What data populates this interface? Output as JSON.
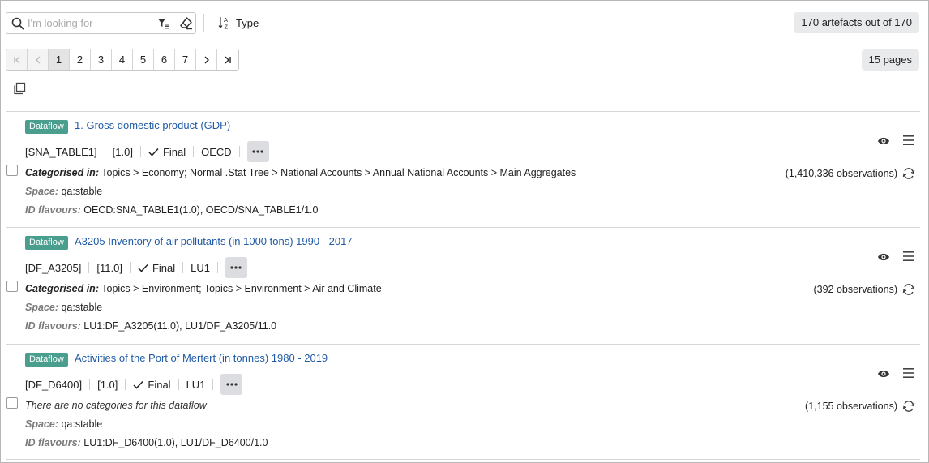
{
  "search": {
    "placeholder": "I'm looking for",
    "value": ""
  },
  "sort": {
    "label": "Type"
  },
  "summary": {
    "count_label": "170 artefacts out of 170",
    "pages_label": "15 pages"
  },
  "pagination": {
    "pages": [
      "1",
      "2",
      "3",
      "4",
      "5",
      "6",
      "7"
    ],
    "current": "1"
  },
  "icons": [
    "search-icon",
    "filter-icon",
    "eraser-icon",
    "sort-icon",
    "copy-icon",
    "first-page-icon",
    "prev-page-icon",
    "next-page-icon",
    "last-page-icon",
    "check-icon",
    "more-icon",
    "eye-icon",
    "menu-icon",
    "refresh-icon"
  ],
  "colors": {
    "badge": "#4a9e8e",
    "link": "#1f5aa6",
    "pill_bg": "#e9eaeb"
  },
  "items": [
    {
      "badge": "Dataflow",
      "title": "1. Gross domestic product (GDP)",
      "id": "[SNA_TABLE1]",
      "version": "[1.0]",
      "status": "Final",
      "agency": "OECD",
      "categorised_label": "Categorised in:",
      "categorised": "Topics > Economy; Normal .Stat Tree > National Accounts > Annual National Accounts > Main Aggregates",
      "space_label": "Space:",
      "space": "qa:stable",
      "flavours_label": "ID flavours:",
      "flavours": "OECD:SNA_TABLE1(1.0), OECD/SNA_TABLE1/1.0",
      "observations": "(1,410,336 observations)"
    },
    {
      "badge": "Dataflow",
      "title": "A3205 Inventory of air pollutants (in 1000 tons) 1990 - 2017",
      "id": "[DF_A3205]",
      "version": "[11.0]",
      "status": "Final",
      "agency": "LU1",
      "categorised_label": "Categorised in:",
      "categorised": "Topics > Environment; Topics > Environment > Air and Climate",
      "space_label": "Space:",
      "space": "qa:stable",
      "flavours_label": "ID flavours:",
      "flavours": "LU1:DF_A3205(11.0), LU1/DF_A3205/11.0",
      "observations": "(392 observations)"
    },
    {
      "badge": "Dataflow",
      "title": "Activities of the Port of Mertert (in tonnes) 1980 - 2019",
      "id": "[DF_D6400]",
      "version": "[1.0]",
      "status": "Final",
      "agency": "LU1",
      "no_categories": "There are no categories for this dataflow",
      "space_label": "Space:",
      "space": "qa:stable",
      "flavours_label": "ID flavours:",
      "flavours": "LU1:DF_D6400(1.0), LU1/DF_D6400/1.0",
      "observations": "(1,155 observations)"
    }
  ]
}
